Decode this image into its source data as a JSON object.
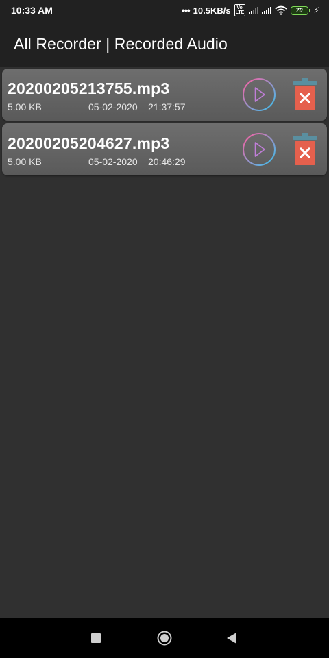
{
  "status_bar": {
    "time": "10:33 AM",
    "speed": "10.5KB/s",
    "volte": "Vo LTE",
    "battery": "70",
    "icons": [
      "dots-icon",
      "volte-icon",
      "signal-icon",
      "signal-icon",
      "wifi-icon",
      "battery-icon",
      "charging-icon"
    ]
  },
  "app_bar": {
    "title": "All Recorder | Recorded Audio"
  },
  "recordings": [
    {
      "name": "20200205213755.mp3",
      "size": "5.00 KB",
      "date": "05-02-2020",
      "time": "21:37:57"
    },
    {
      "name": "20200205204627.mp3",
      "size": "5.00 KB",
      "date": "05-02-2020",
      "time": "20:46:29"
    }
  ],
  "colors": {
    "background": "#303030",
    "toolbar": "#212121",
    "card": "#636363",
    "delete_red": "#e5604d",
    "trash_lid": "#5a8fa0",
    "play_gradient_start": "#ff5ea1",
    "play_gradient_end": "#36c3f0",
    "battery_green": "#7ed957"
  },
  "nav_bar": {
    "icons": [
      "recents-icon",
      "home-icon",
      "back-icon"
    ]
  }
}
